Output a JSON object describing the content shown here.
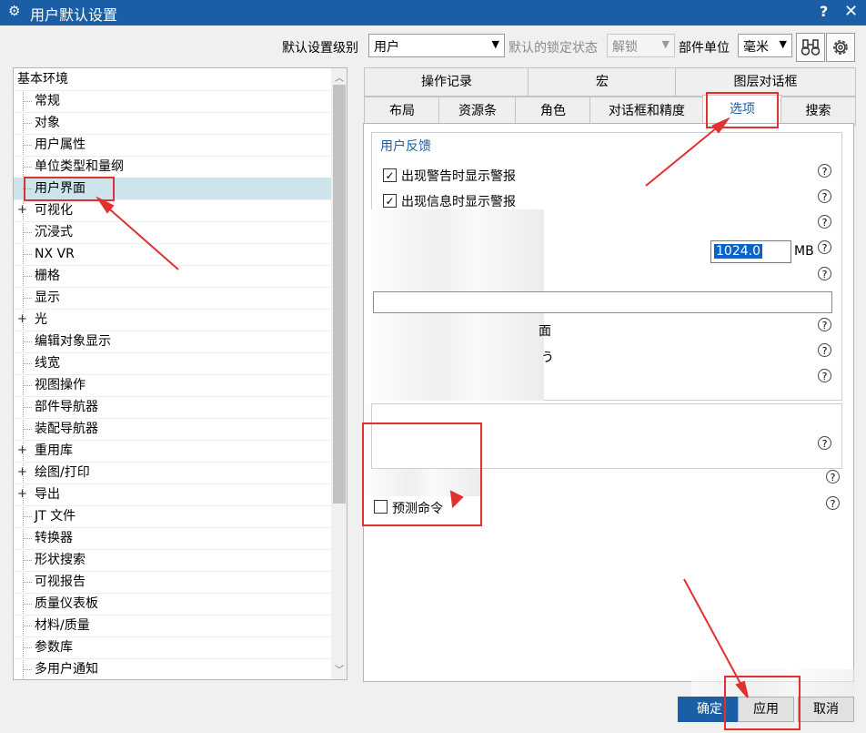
{
  "window": {
    "title": "用户默认设置",
    "help": "?",
    "close": "x"
  },
  "toolbar": {
    "level_label": "默认设置级别",
    "level_value": "用户",
    "lock_label": "默认的锁定状态",
    "lock_value": "解锁",
    "unit_label": "部件单位",
    "unit_value": "毫米"
  },
  "tree": {
    "root": "基本环境",
    "items": [
      {
        "label": "常规",
        "expandable": false
      },
      {
        "label": "对象",
        "expandable": false
      },
      {
        "label": "用户属性",
        "expandable": false
      },
      {
        "label": "单位类型和量纲",
        "expandable": false
      },
      {
        "label": "用户界面",
        "expandable": false,
        "selected": true
      },
      {
        "label": "可视化",
        "expandable": true
      },
      {
        "label": "沉浸式",
        "expandable": false
      },
      {
        "label": "NX VR",
        "expandable": false
      },
      {
        "label": "栅格",
        "expandable": false
      },
      {
        "label": "显示",
        "expandable": false
      },
      {
        "label": "光",
        "expandable": true
      },
      {
        "label": "编辑对象显示",
        "expandable": false
      },
      {
        "label": "线宽",
        "expandable": false
      },
      {
        "label": "视图操作",
        "expandable": false
      },
      {
        "label": "部件导航器",
        "expandable": false
      },
      {
        "label": "装配导航器",
        "expandable": false
      },
      {
        "label": "重用库",
        "expandable": true
      },
      {
        "label": "绘图/打印",
        "expandable": true
      },
      {
        "label": "导出",
        "expandable": true
      },
      {
        "label": "JT 文件",
        "expandable": false
      },
      {
        "label": "转换器",
        "expandable": false
      },
      {
        "label": "形状搜索",
        "expandable": false
      },
      {
        "label": "可视报告",
        "expandable": false
      },
      {
        "label": "质量仪表板",
        "expandable": false
      },
      {
        "label": "材料/质量",
        "expandable": false
      },
      {
        "label": "参数库",
        "expandable": false
      },
      {
        "label": "多用户通知",
        "expandable": false
      }
    ]
  },
  "tabs": {
    "row1": [
      "操作记录",
      "宏",
      "图层对话框"
    ],
    "row2": [
      "布局",
      "资源条",
      "角色",
      "对话框和精度",
      "选项",
      "搜索"
    ],
    "active": "选项"
  },
  "options": {
    "group_title": "用户反馈",
    "warn_label": "出现警告时显示警报",
    "warn_checked": true,
    "info_label": "出现信息时显示警报",
    "info_checked": true,
    "memory_value": "1024.0",
    "memory_unit": "MB",
    "partial_1": "面",
    "partial_2": "う",
    "predict_label": "预测命令",
    "predict_checked": false
  },
  "buttons": {
    "ok": "确定",
    "apply": "应用",
    "cancel": "取消"
  },
  "colors": {
    "titlebar": "#1a5fa6",
    "selection": "#cde4ed",
    "annotation": "#e03030",
    "accent_text": "#1a5fa6"
  }
}
